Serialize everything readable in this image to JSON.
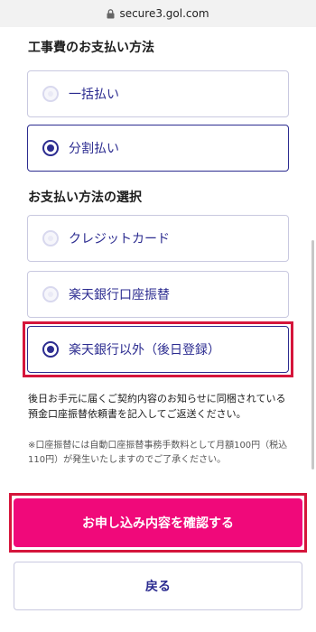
{
  "browser": {
    "url": "secure3.gol.com"
  },
  "construction_payment": {
    "heading": "工事費のお支払い方法",
    "options": [
      {
        "label": "一括払い",
        "selected": false
      },
      {
        "label": "分割払い",
        "selected": true
      }
    ]
  },
  "payment_method": {
    "heading": "お支払い方法の選択",
    "options": [
      {
        "label": "クレジットカード",
        "selected": false
      },
      {
        "label": "楽天銀行口座振替",
        "selected": false
      },
      {
        "label": "楽天銀行以外（後日登録）",
        "selected": true
      }
    ]
  },
  "notes": {
    "main": "後日お手元に届くご契約内容のお知らせに同梱されている預金口座振替依頼書を記入してご返送ください。",
    "fee": "※口座振替には自動口座振替事務手数料として月額100円（税込110円）が発生いたしますのでご了承ください。"
  },
  "buttons": {
    "confirm": "お申し込み内容を確認する",
    "back": "戻る"
  },
  "colors": {
    "accent": "#2c2c90",
    "primary_button": "#f0097a",
    "highlight": "#d5153b"
  }
}
